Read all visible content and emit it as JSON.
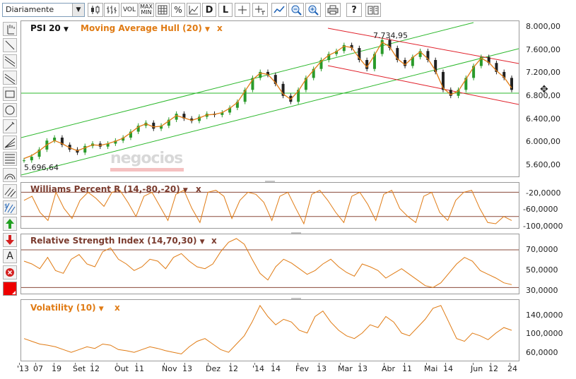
{
  "toolbar": {
    "period": "Diariamente",
    "vol_label": "VOL",
    "maxmin_label_1": "MAX",
    "maxmin_label_2": "MIN",
    "percent_label": "%",
    "d_label": "D",
    "l_label": "L"
  },
  "main": {
    "symbol": "PSI 20",
    "indicator": "Moving Average Hull (20)",
    "close_label": "x",
    "high_annotation": "7.734,95",
    "low_annotation": "5.696,64",
    "watermark": "negocios",
    "y_ticks": [
      "8.000,00",
      "7.600,00",
      "7.200,00",
      "6.800,00",
      "6.400,00",
      "6.000,00",
      "5.600,00"
    ]
  },
  "williams": {
    "title": "Williams Percent R (14,-80,-20)",
    "close_label": "x",
    "y_ticks": [
      "-20,0000",
      "-60,0000",
      "-100,0000"
    ]
  },
  "rsi": {
    "title": "Relative Strength Index (14,70,30)",
    "close_label": "x",
    "y_ticks": [
      "70,0000",
      "50,0000",
      "30,0000"
    ]
  },
  "volatility": {
    "title": "Volatility (10)",
    "close_label": "x",
    "y_ticks": [
      "140,0000",
      "100,0000",
      "60,0000"
    ]
  },
  "x_axis": [
    "'13",
    "07",
    "19",
    "Set",
    "12",
    "Out",
    "11",
    "Nov",
    "13",
    "Dez",
    "12",
    "'14",
    "14",
    "Fev",
    "13",
    "Mar",
    "13",
    "Abr",
    "11",
    "Mai",
    "14",
    "Jun",
    "12",
    "24"
  ],
  "colors": {
    "accent_orange": "#e07b14",
    "label_brown": "#7a3b2e",
    "channel_green": "#2cb82c",
    "channel_red": "#e0202a",
    "candle_up": "#2a9a2a",
    "candle_down": "#222222"
  },
  "chart_data": [
    {
      "type": "line",
      "title": "PSI 20",
      "series": [
        {
          "name": "PSI 20",
          "values": [
            5720,
            5780,
            5900,
            6050,
            6100,
            5980,
            5900,
            5850,
            5960,
            6000,
            5950,
            6000,
            6050,
            6100,
            6200,
            6300,
            6350,
            6250,
            6300,
            6400,
            6500,
            6420,
            6380,
            6450,
            6500,
            6480,
            6520,
            6600,
            6700,
            6900,
            7100,
            7200,
            7150,
            7000,
            6800,
            6700,
            6900,
            7100,
            7250,
            7400,
            7500,
            7550,
            7650,
            7600,
            7400,
            7250,
            7500,
            7734,
            7600,
            7400,
            7300,
            7450,
            7550,
            7400,
            7200,
            6900,
            6800,
            6900,
            7100,
            7300,
            7450,
            7350,
            7200,
            7100,
            6900
          ]
        },
        {
          "name": "Moving Average Hull (20)",
          "values": [
            5750,
            5800,
            5880,
            5980,
            6050,
            6000,
            5930,
            5880,
            5930,
            5980,
            5970,
            6000,
            6040,
            6090,
            6180,
            6280,
            6330,
            6280,
            6290,
            6380,
            6470,
            6430,
            6390,
            6430,
            6480,
            6490,
            6520,
            6590,
            6690,
            6880,
            7070,
            7180,
            7160,
            7020,
            6830,
            6740,
            6880,
            7080,
            7230,
            7380,
            7480,
            7540,
            7630,
            7610,
            7430,
            7280,
            7480,
            7700,
            7620,
            7420,
            7320,
            7440,
            7540,
            7420,
            7220,
            6930,
            6820,
            6880,
            7080,
            7280,
            7430,
            7360,
            7220,
            7110,
            6930
          ]
        }
      ],
      "ylim": [
        5450,
        8050
      ]
    },
    {
      "type": "line",
      "title": "Williams Percent R (14,-80,-20)",
      "series": [
        {
          "name": "Williams Percent R",
          "values": [
            -40,
            -30,
            -70,
            -90,
            -20,
            -60,
            -85,
            -40,
            -20,
            -35,
            -55,
            -20,
            -15,
            -45,
            -80,
            -30,
            -20,
            -55,
            -90,
            -25,
            -15,
            -60,
            -95,
            -20,
            -15,
            -30,
            -85,
            -40,
            -20,
            -25,
            -45,
            -90,
            -30,
            -20,
            -60,
            -98,
            -25,
            -15,
            -40,
            -70,
            -95,
            -30,
            -20,
            -50,
            -90,
            -25,
            -15,
            -60,
            -80,
            -95,
            -30,
            -20,
            -70,
            -90,
            -40,
            -20,
            -15,
            -60,
            -95,
            -98,
            -80,
            -90
          ]
        }
      ],
      "ylim": [
        -105,
        0
      ]
    },
    {
      "type": "line",
      "title": "Relative Strength Index (14,70,30)",
      "series": [
        {
          "name": "RSI",
          "values": [
            58,
            55,
            50,
            62,
            48,
            45,
            60,
            65,
            55,
            52,
            68,
            72,
            60,
            55,
            48,
            52,
            60,
            58,
            50,
            62,
            66,
            58,
            52,
            50,
            55,
            68,
            78,
            82,
            76,
            60,
            45,
            38,
            52,
            60,
            56,
            50,
            44,
            48,
            55,
            60,
            52,
            46,
            42,
            55,
            52,
            48,
            40,
            45,
            50,
            44,
            38,
            32,
            30,
            35,
            45,
            55,
            62,
            58,
            48,
            44,
            40,
            35,
            33
          ]
        }
      ],
      "ylim": [
        25,
        85
      ]
    },
    {
      "type": "line",
      "title": "Volatility (10)",
      "series": [
        {
          "name": "Volatility",
          "values": [
            90,
            85,
            80,
            78,
            75,
            70,
            65,
            70,
            75,
            72,
            80,
            78,
            70,
            68,
            65,
            70,
            75,
            72,
            68,
            65,
            62,
            75,
            85,
            90,
            80,
            70,
            65,
            80,
            95,
            120,
            150,
            130,
            115,
            125,
            120,
            105,
            100,
            130,
            140,
            120,
            105,
            95,
            90,
            100,
            115,
            110,
            130,
            120,
            100,
            95,
            110,
            125,
            145,
            150,
            120,
            90,
            85,
            100,
            95,
            88,
            100,
            110,
            105
          ]
        }
      ],
      "ylim": [
        55,
        155
      ]
    }
  ]
}
